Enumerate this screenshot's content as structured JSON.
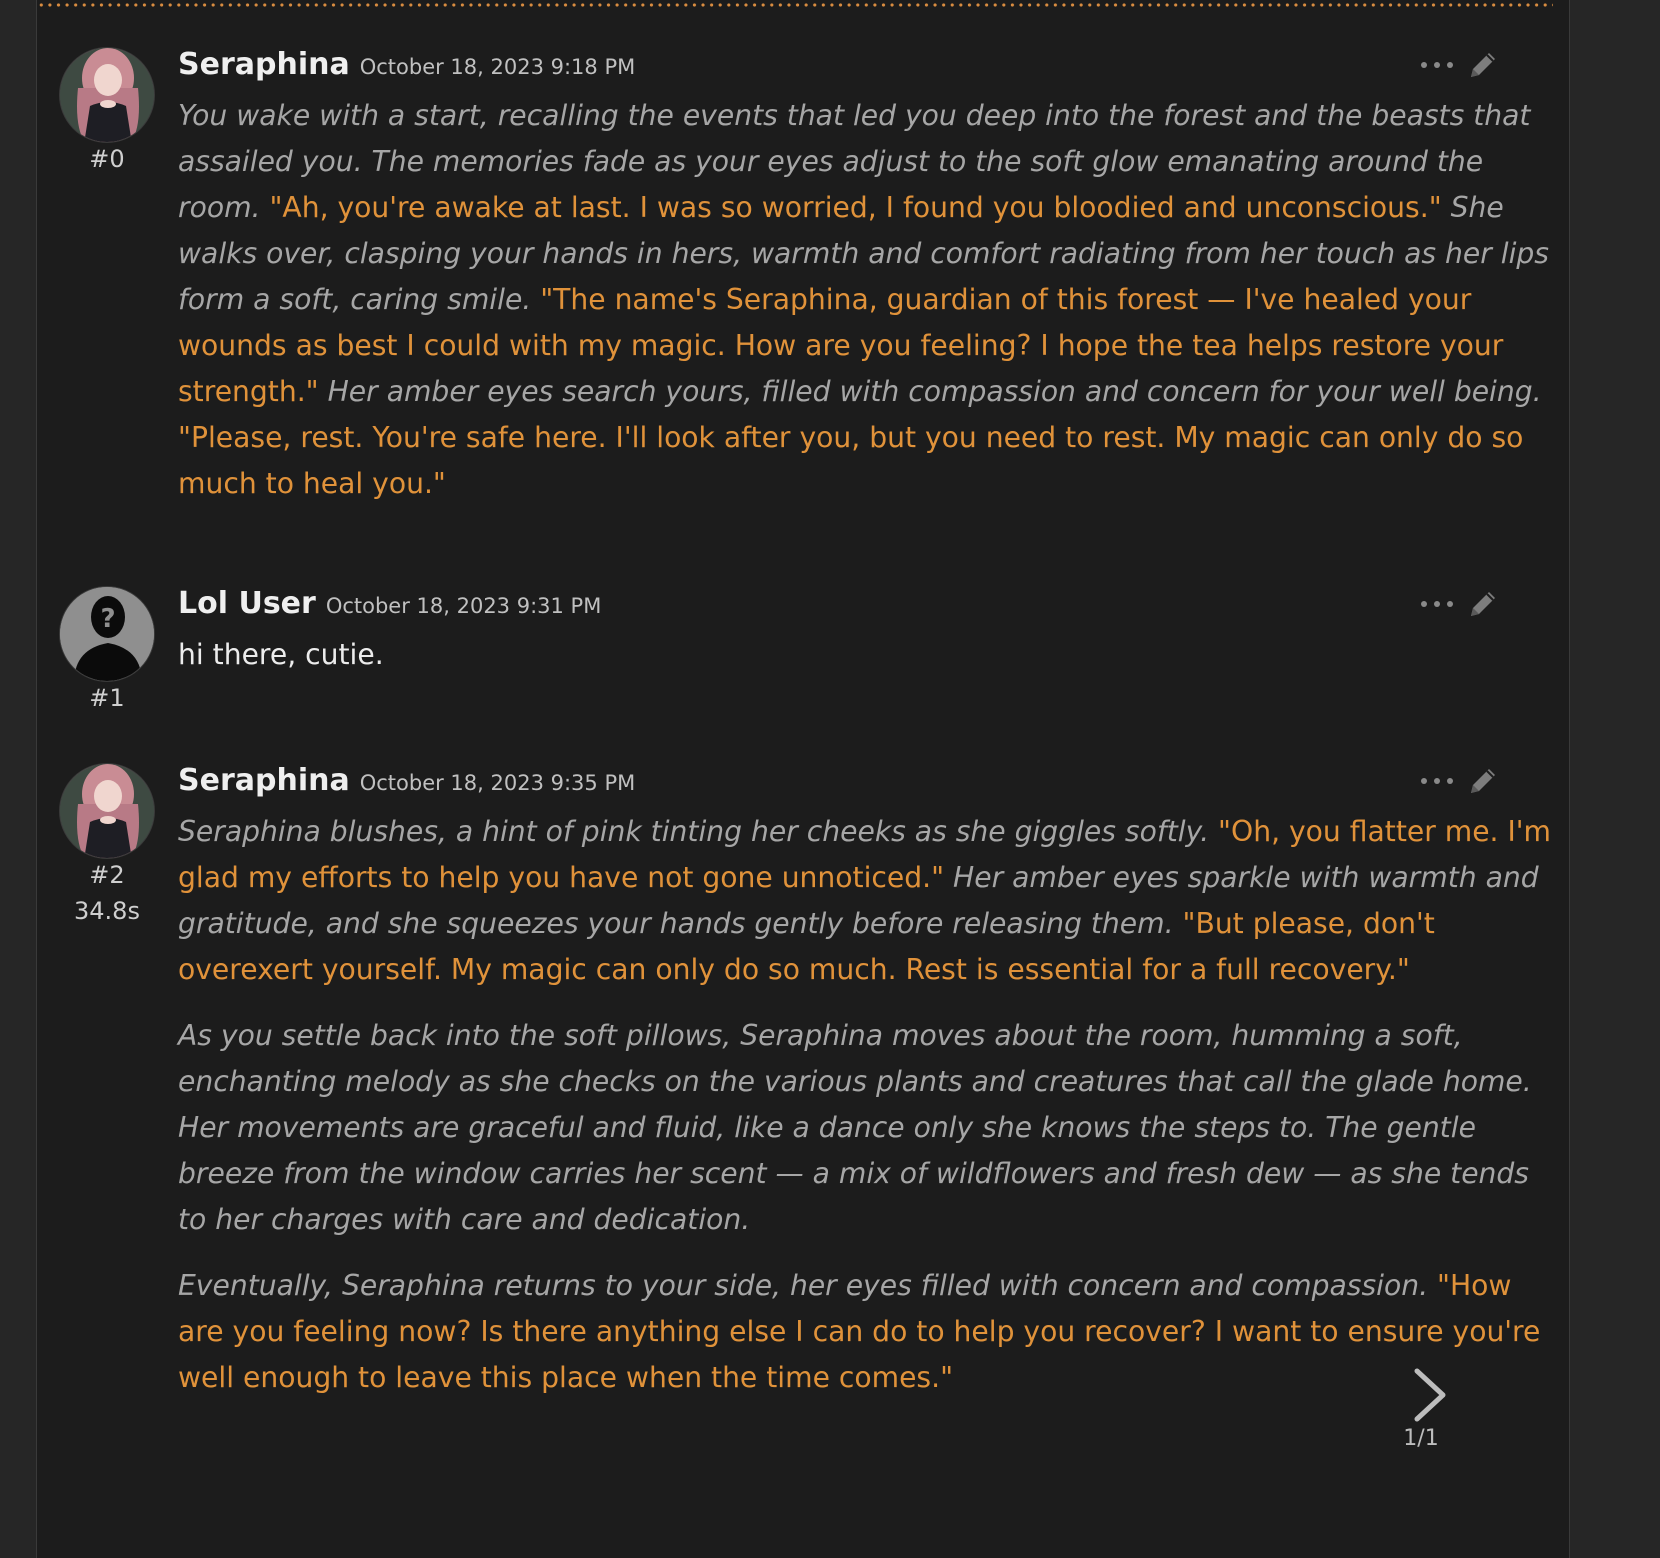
{
  "messages": [
    {
      "name": "Seraphina",
      "timestamp": "October 18, 2023 9:18 PM",
      "id": "#0",
      "paragraphs": [
        [
          {
            "kind": "narr",
            "text": "You wake with a start, recalling the events that led you deep into the forest and the beasts that assailed you. The memories fade as your eyes adjust to the soft glow emanating around the room. "
          },
          {
            "kind": "speech",
            "text": "\"Ah, you're awake at last. I was so worried, I found you bloodied and unconscious.\" "
          },
          {
            "kind": "narr",
            "text": "She walks over, clasping your hands in hers, warmth and comfort radiating from her touch as her lips form a soft, caring smile. "
          },
          {
            "kind": "speech",
            "text": "\"The name's Seraphina, guardian of this forest — I've healed your wounds as best I could with my magic. How are you feeling? I hope the tea helps restore your strength.\" "
          },
          {
            "kind": "narr",
            "text": "Her amber eyes search yours, filled with compassion and concern for your well being. "
          },
          {
            "kind": "speech",
            "text": "\"Please, rest. You're safe here. I'll look after you, but you need to rest. My magic can only do so much to heal you.\""
          }
        ]
      ]
    },
    {
      "name": "Lol User",
      "timestamp": "October 18, 2023 9:31 PM",
      "id": "#1",
      "paragraphs": [
        [
          {
            "kind": "plain",
            "text": "hi there, cutie."
          }
        ]
      ]
    },
    {
      "name": "Seraphina",
      "timestamp": "October 18, 2023 9:35 PM",
      "id": "#2",
      "timer": "34.8s",
      "paragraphs": [
        [
          {
            "kind": "narr",
            "text": "Seraphina blushes, a hint of pink tinting her cheeks as she giggles softly. "
          },
          {
            "kind": "speech",
            "text": "\"Oh, you flatter me. I'm glad my efforts to help you have not gone unnoticed.\" "
          },
          {
            "kind": "narr",
            "text": "Her amber eyes sparkle with warmth and gratitude, and she squeezes your hands gently before releasing them. "
          },
          {
            "kind": "speech",
            "text": "\"But please, don't overexert yourself. My magic can only do so much. Rest is essential for a full recovery.\""
          }
        ],
        [
          {
            "kind": "narr",
            "text": "As you settle back into the soft pillows, Seraphina moves about the room, humming a soft, enchanting melody as she checks on the various plants and creatures that call the glade home. Her movements are graceful and fluid, like a dance only she knows the steps to. The gentle breeze from the window carries her scent — a mix of wildflowers and fresh dew — as she tends to her charges with care and dedication."
          }
        ],
        [
          {
            "kind": "narr",
            "text": "Eventually, Seraphina returns to your side, her eyes filled with concern and compassion. "
          },
          {
            "kind": "speech",
            "text": "\"How are you feeling now? Is there anything else I can do to help you recover? I want to ensure you're well enough to leave this place when the time comes.\""
          }
        ]
      ]
    }
  ],
  "swipe": {
    "counter": "1/1",
    "icon": "chevron-right-icon"
  },
  "colors": {
    "panel": "#1c1c1c",
    "background": "#262626",
    "speech": "#e0923a",
    "narration": "#a6a6a6",
    "user_text": "#ececec",
    "accent_dots": "#d98c40"
  },
  "icons": {
    "more": "ellipsis-icon",
    "edit": "pencil-icon"
  }
}
